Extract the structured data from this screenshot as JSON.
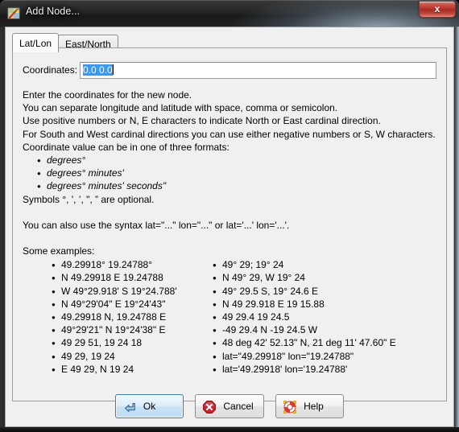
{
  "window": {
    "title": "Add Node...",
    "icon": "josm-map-icon",
    "close_label": "x",
    "accent_blue": "#3399ff",
    "close_red": "#b8332a"
  },
  "tabs": [
    {
      "label": "Lat/Lon",
      "active": true
    },
    {
      "label": "East/North",
      "active": false
    }
  ],
  "coordinates": {
    "label": "Coordinates:",
    "value": "0.0 0.0",
    "placeholder": "",
    "selected": true
  },
  "instructions": {
    "lines": [
      "Enter the coordinates for the new node.",
      "You can separate longitude and latitude with space, comma or semicolon.",
      "Use positive numbers or N, E characters to indicate North or East cardinal direction.",
      "For South and West cardinal directions you can use either negative numbers or S, W characters.",
      "Coordinate value can be in one of three formats:"
    ],
    "formats": [
      "degrees°",
      "degrees° minutes'",
      "degrees° minutes' seconds\""
    ],
    "symbols_note": "Symbols °, ', ’, \", ” are optional.",
    "syntax_note": "You can also use the syntax lat=\"...\" lon=\"...\" or lat='...' lon='...'."
  },
  "examples": {
    "heading": "Some examples:",
    "left": [
      "49.29918° 19.24788°",
      "N 49.29918 E 19.24788",
      "W 49°29.918' S 19°24.788'",
      "N 49°29'04\" E 19°24'43\"",
      "49.29918 N, 19.24788 E",
      "49°29'21\" N 19°24'38\" E",
      "49 29 51, 19 24 18",
      "49 29, 19 24",
      "E 49 29, N 19 24"
    ],
    "right": [
      "49° 29; 19° 24",
      "N 49° 29, W 19° 24",
      "49° 29.5 S, 19° 24.6 E",
      "N 49 29.918 E 19 15.88",
      "49 29.4 19 24.5",
      "-49 29.4 N -19 24.5 W",
      "48 deg 42' 52.13\" N, 21 deg 11' 47.60\" E",
      "lat=\"49.29918\" lon=\"19.24788\"",
      "lat='49.29918' lon='19.24788'"
    ]
  },
  "buttons": [
    {
      "label": "Ok",
      "icon": "enter-arrow-icon",
      "focused": true
    },
    {
      "label": "Cancel",
      "icon": "octagon-x-icon",
      "focused": false
    },
    {
      "label": "Help",
      "icon": "lifebuoy-icon",
      "focused": false
    }
  ]
}
